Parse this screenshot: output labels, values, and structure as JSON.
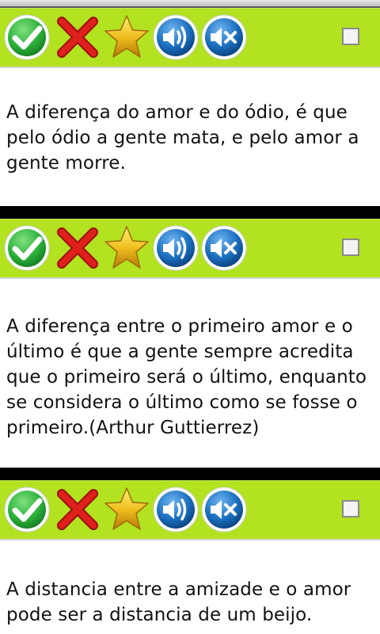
{
  "quotes": [
    {
      "text": "A diferença do amor e do ódio, é que pelo ódio a gente mata, e pelo amor a gente morre."
    },
    {
      "text": "A diferença entre o primeiro amor e o último é que a gente sempre acredita que o primeiro será o último, enquanto se considera o último como se fosse o primeiro.(Arthur Guttierrez)"
    },
    {
      "text": "A distancia entre a amizade e o amor pode ser a distancia de um beijo."
    }
  ],
  "toolbar_icons": [
    "check-icon",
    "x-icon",
    "star-icon",
    "speaker-icon",
    "mute-icon"
  ],
  "colors": {
    "toolbar_green": "#b2e220",
    "check_green": "#2cb13a",
    "x_red": "#e0201c",
    "star_gold": "#f0c020",
    "sound_blue": "#1a6fbf",
    "separator": "#000000"
  }
}
